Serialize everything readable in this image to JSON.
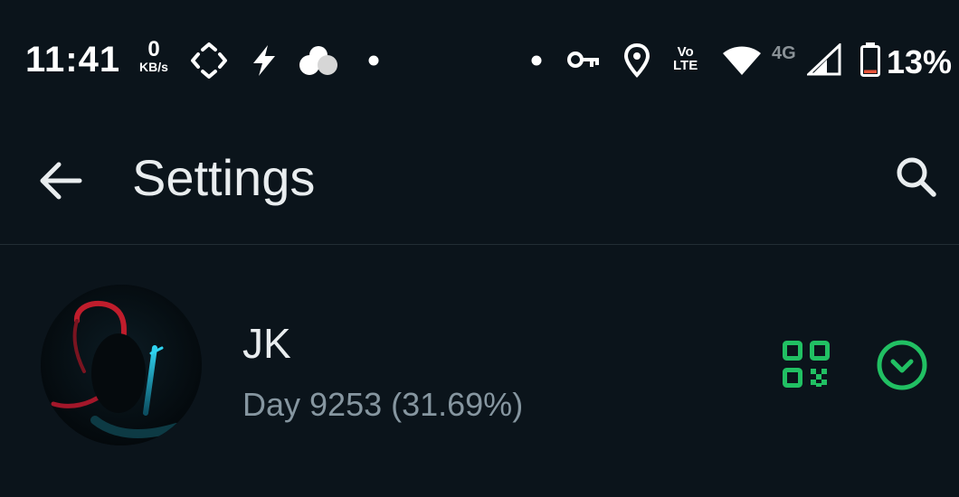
{
  "status_bar": {
    "time": "11:41",
    "net_speed_value": "0",
    "net_speed_unit": "KB/s",
    "volte_top": "Vo",
    "volte_bottom": "LTE",
    "network_type": "4G",
    "battery_percent": "13%",
    "battery_level": 0.13,
    "icons": [
      "diamond-arrows-icon",
      "flash-icon",
      "cloud-icon",
      "dot-icon",
      "dot-icon",
      "key-icon",
      "location-icon",
      "volte-icon",
      "wifi-icon",
      "signal-icon",
      "battery-icon"
    ]
  },
  "app_bar": {
    "title": "Settings",
    "back_icon": "back-arrow-icon",
    "search_icon": "search-icon"
  },
  "profile": {
    "name": "JK",
    "status": "Day 9253 (31.69%)",
    "qr_icon": "qr-code-icon",
    "expand_icon": "chevron-down-circle-icon"
  },
  "colors": {
    "background": "#0b141b",
    "accent_green": "#21c063",
    "text_primary": "#e9edef",
    "text_secondary": "#8696a0",
    "battery_low": "#e8543a"
  }
}
